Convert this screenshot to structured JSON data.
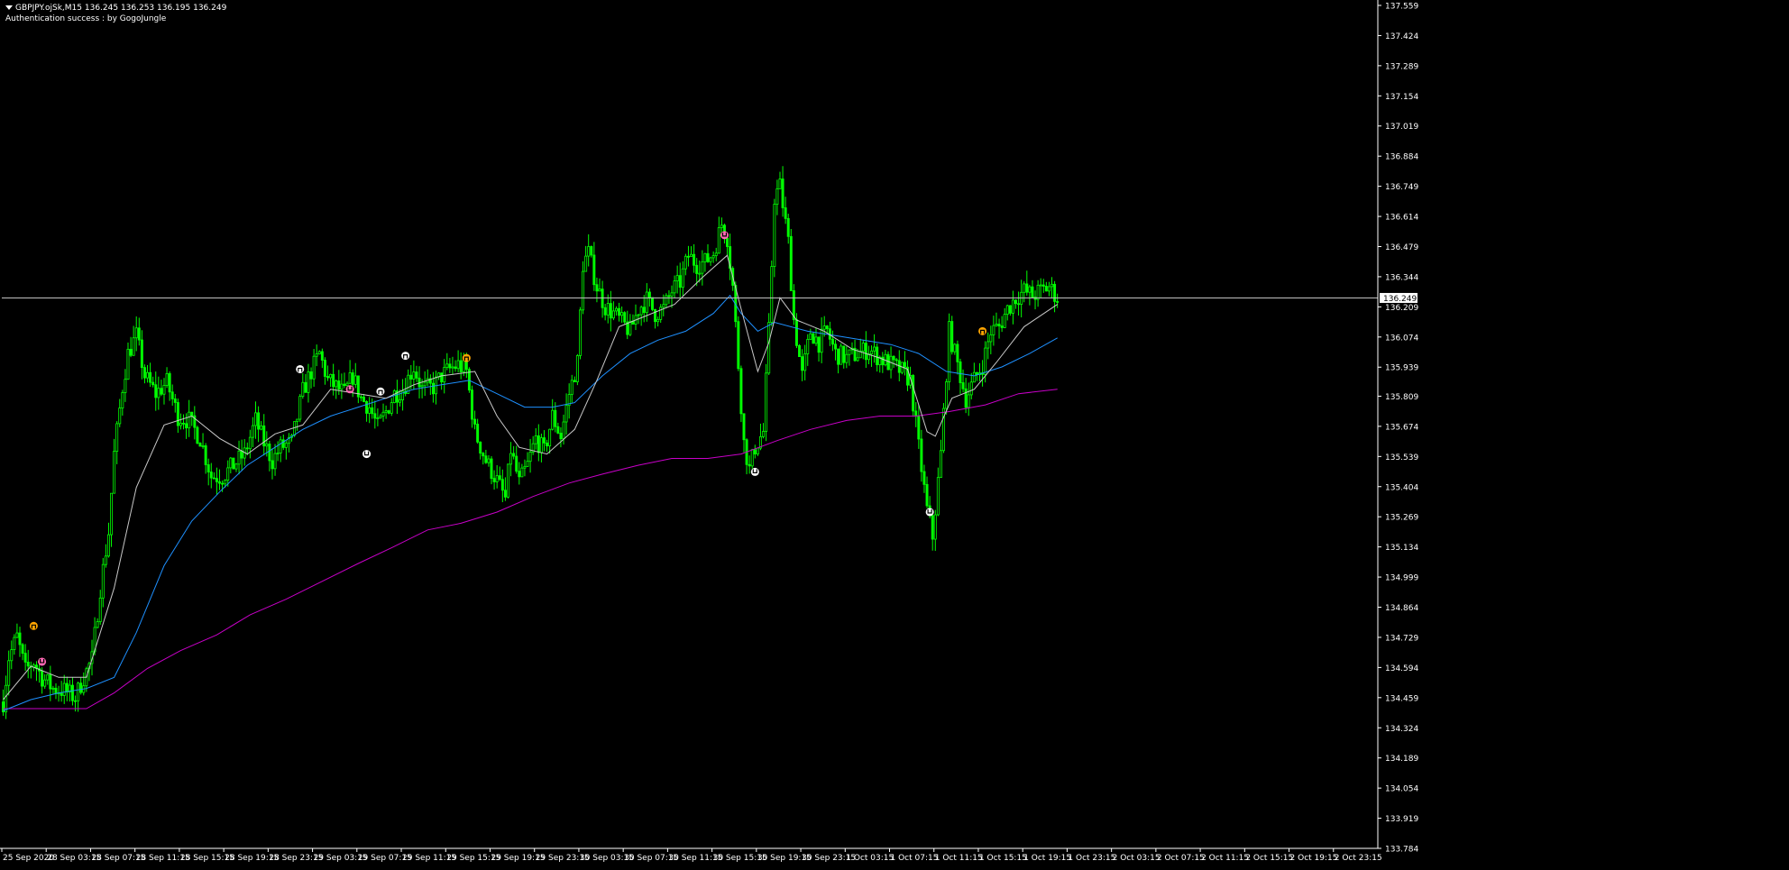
{
  "header": {
    "symbol_line": "GBPJPY.ojSk,M15  136.245 136.253 136.195 136.249",
    "auth_line": "Authentication success : by GogoJungle"
  },
  "colors": {
    "background": "#000000",
    "candle": "#00ff00",
    "ma_fast": "#c8c8c8",
    "ma_mid": "#1e90ff",
    "ma_slow": "#c800c8",
    "axis": "#ffffff",
    "price_line": "#c0c0c0",
    "sig_white": "#ffffff",
    "sig_orange": "#ffa500",
    "sig_pink": "#ff69b4"
  },
  "chart_data": {
    "type": "candlestick",
    "symbol": "GBPJPY.ojSk",
    "timeframe": "M15",
    "ohlc_current": {
      "open": 136.245,
      "high": 136.253,
      "low": 136.195,
      "close": 136.249
    },
    "current_price_label": "136.249",
    "current_price": 136.249,
    "ylim": [
      133.784,
      137.559
    ],
    "y_ticks": [
      "137.559",
      "137.424",
      "137.289",
      "137.154",
      "137.019",
      "136.884",
      "136.749",
      "136.614",
      "136.479",
      "136.344",
      "136.209",
      "136.074",
      "135.939",
      "135.809",
      "135.674",
      "135.539",
      "135.404",
      "135.269",
      "135.134",
      "134.999",
      "134.864",
      "134.729",
      "134.594",
      "134.459",
      "134.324",
      "134.189",
      "134.054",
      "133.919",
      "133.784"
    ],
    "x_ticks": [
      "25 Sep 2020",
      "28 Sep 03:15",
      "28 Sep 07:15",
      "28 Sep 11:15",
      "28 Sep 15:15",
      "28 Sep 19:15",
      "28 Sep 23:15",
      "29 Sep 03:15",
      "29 Sep 07:15",
      "29 Sep 11:15",
      "29 Sep 15:15",
      "29 Sep 19:15",
      "29 Sep 23:15",
      "30 Sep 03:15",
      "30 Sep 07:15",
      "30 Sep 11:15",
      "30 Sep 15:15",
      "30 Sep 19:15",
      "30 Sep 23:15",
      "1 Oct 03:15",
      "1 Oct 07:15",
      "1 Oct 11:15",
      "1 Oct 15:15",
      "1 Oct 19:15",
      "1 Oct 23:15",
      "2 Oct 03:15",
      "2 Oct 07:15",
      "2 Oct 11:15",
      "2 Oct 15:15",
      "2 Oct 19:15",
      "2 Oct 23:15"
    ],
    "bars_per_tick": 16,
    "close_path": [
      [
        0,
        134.44
      ],
      [
        2,
        134.64
      ],
      [
        5,
        134.73
      ],
      [
        8,
        134.58
      ],
      [
        11,
        134.62
      ],
      [
        14,
        134.55
      ],
      [
        18,
        134.5
      ],
      [
        22,
        134.49
      ],
      [
        26,
        134.46
      ],
      [
        29,
        134.55
      ],
      [
        32,
        134.63
      ],
      [
        35,
        134.95
      ],
      [
        38,
        135.2
      ],
      [
        40,
        135.55
      ],
      [
        43,
        135.85
      ],
      [
        45,
        136.0
      ],
      [
        48,
        136.08
      ],
      [
        51,
        135.9
      ],
      [
        55,
        135.82
      ],
      [
        59,
        135.87
      ],
      [
        63,
        135.72
      ],
      [
        67,
        135.7
      ],
      [
        71,
        135.62
      ],
      [
        75,
        135.45
      ],
      [
        79,
        135.45
      ],
      [
        83,
        135.5
      ],
      [
        87,
        135.55
      ],
      [
        91,
        135.7
      ],
      [
        94,
        135.6
      ],
      [
        97,
        135.52
      ],
      [
        100,
        135.58
      ],
      [
        104,
        135.6
      ],
      [
        108,
        135.83
      ],
      [
        111,
        135.92
      ],
      [
        114,
        136.0
      ],
      [
        117,
        135.88
      ],
      [
        120,
        135.85
      ],
      [
        123,
        135.82
      ],
      [
        126,
        135.9
      ],
      [
        129,
        135.8
      ],
      [
        132,
        135.76
      ],
      [
        135,
        135.67
      ],
      [
        138,
        135.74
      ],
      [
        141,
        135.82
      ],
      [
        144,
        135.84
      ],
      [
        148,
        135.94
      ],
      [
        151,
        135.84
      ],
      [
        155,
        135.85
      ],
      [
        158,
        135.9
      ],
      [
        161,
        135.93
      ],
      [
        164,
        135.95
      ],
      [
        167,
        135.92
      ],
      [
        170,
        135.65
      ],
      [
        174,
        135.52
      ],
      [
        178,
        135.43
      ],
      [
        181,
        135.35
      ],
      [
        183,
        135.57
      ],
      [
        186,
        135.42
      ],
      [
        189,
        135.5
      ],
      [
        192,
        135.62
      ],
      [
        195,
        135.56
      ],
      [
        198,
        135.72
      ],
      [
        201,
        135.63
      ],
      [
        204,
        135.82
      ],
      [
        207,
        135.96
      ],
      [
        209,
        136.4
      ],
      [
        211,
        136.45
      ],
      [
        214,
        136.3
      ],
      [
        217,
        136.21
      ],
      [
        220,
        136.18
      ],
      [
        223,
        136.14
      ],
      [
        226,
        136.1
      ],
      [
        229,
        136.2
      ],
      [
        232,
        136.24
      ],
      [
        235,
        136.18
      ],
      [
        238,
        136.2
      ],
      [
        241,
        136.28
      ],
      [
        244,
        136.32
      ],
      [
        247,
        136.44
      ],
      [
        250,
        136.4
      ],
      [
        253,
        136.41
      ],
      [
        256,
        136.45
      ],
      [
        259,
        136.58
      ],
      [
        261,
        136.52
      ],
      [
        263,
        136.3
      ],
      [
        265,
        135.95
      ],
      [
        267,
        135.6
      ],
      [
        269,
        135.48
      ],
      [
        271,
        135.58
      ],
      [
        274,
        135.65
      ],
      [
        276,
        136.1
      ],
      [
        278,
        136.7
      ],
      [
        280,
        136.75
      ],
      [
        283,
        136.5
      ],
      [
        285,
        136.15
      ],
      [
        288,
        135.9
      ],
      [
        291,
        136.1
      ],
      [
        294,
        136.05
      ],
      [
        297,
        136.1
      ],
      [
        300,
        136.0
      ],
      [
        304,
        135.98
      ],
      [
        308,
        136.0
      ],
      [
        312,
        136.02
      ],
      [
        316,
        135.98
      ],
      [
        320,
        135.95
      ],
      [
        324,
        135.92
      ],
      [
        327,
        135.88
      ],
      [
        330,
        135.58
      ],
      [
        333,
        135.3
      ],
      [
        335,
        135.18
      ],
      [
        338,
        135.55
      ],
      [
        341,
        136.1
      ],
      [
        344,
        135.95
      ],
      [
        347,
        135.8
      ],
      [
        350,
        135.88
      ],
      [
        353,
        135.95
      ],
      [
        356,
        136.1
      ],
      [
        359,
        136.12
      ],
      [
        362,
        136.2
      ],
      [
        365,
        136.25
      ],
      [
        368,
        136.28
      ],
      [
        371,
        136.26
      ],
      [
        374,
        136.28
      ],
      [
        377,
        136.3
      ],
      [
        380,
        136.25
      ]
    ],
    "ma_fast": [
      [
        0,
        134.45
      ],
      [
        10,
        134.6
      ],
      [
        20,
        134.55
      ],
      [
        30,
        134.55
      ],
      [
        40,
        134.95
      ],
      [
        48,
        135.4
      ],
      [
        58,
        135.68
      ],
      [
        68,
        135.72
      ],
      [
        78,
        135.62
      ],
      [
        88,
        135.55
      ],
      [
        98,
        135.64
      ],
      [
        108,
        135.68
      ],
      [
        118,
        135.84
      ],
      [
        128,
        135.82
      ],
      [
        138,
        135.8
      ],
      [
        148,
        135.86
      ],
      [
        158,
        135.9
      ],
      [
        170,
        135.92
      ],
      [
        178,
        135.72
      ],
      [
        186,
        135.58
      ],
      [
        196,
        135.55
      ],
      [
        206,
        135.66
      ],
      [
        214,
        135.88
      ],
      [
        222,
        136.12
      ],
      [
        232,
        136.17
      ],
      [
        242,
        136.22
      ],
      [
        252,
        136.34
      ],
      [
        261,
        136.44
      ],
      [
        266,
        136.2
      ],
      [
        272,
        135.92
      ],
      [
        276,
        136.05
      ],
      [
        280,
        136.25
      ],
      [
        286,
        136.15
      ],
      [
        296,
        136.1
      ],
      [
        306,
        136.02
      ],
      [
        316,
        135.98
      ],
      [
        326,
        135.93
      ],
      [
        333,
        135.65
      ],
      [
        336,
        135.63
      ],
      [
        342,
        135.8
      ],
      [
        350,
        135.84
      ],
      [
        358,
        135.96
      ],
      [
        368,
        136.12
      ],
      [
        380,
        136.22
      ]
    ],
    "ma_mid": [
      [
        0,
        134.4
      ],
      [
        10,
        134.45
      ],
      [
        20,
        134.48
      ],
      [
        30,
        134.5
      ],
      [
        40,
        134.55
      ],
      [
        48,
        134.75
      ],
      [
        58,
        135.05
      ],
      [
        68,
        135.25
      ],
      [
        78,
        135.38
      ],
      [
        88,
        135.5
      ],
      [
        98,
        135.58
      ],
      [
        108,
        135.66
      ],
      [
        118,
        135.72
      ],
      [
        128,
        135.76
      ],
      [
        138,
        135.8
      ],
      [
        148,
        135.84
      ],
      [
        158,
        135.86
      ],
      [
        168,
        135.88
      ],
      [
        178,
        135.82
      ],
      [
        188,
        135.76
      ],
      [
        198,
        135.76
      ],
      [
        206,
        135.78
      ],
      [
        216,
        135.9
      ],
      [
        226,
        136.0
      ],
      [
        236,
        136.06
      ],
      [
        246,
        136.1
      ],
      [
        256,
        136.18
      ],
      [
        262,
        136.26
      ],
      [
        266,
        136.18
      ],
      [
        272,
        136.1
      ],
      [
        278,
        136.14
      ],
      [
        290,
        136.1
      ],
      [
        300,
        136.08
      ],
      [
        310,
        136.06
      ],
      [
        320,
        136.04
      ],
      [
        330,
        136.0
      ],
      [
        340,
        135.92
      ],
      [
        350,
        135.9
      ],
      [
        360,
        135.94
      ],
      [
        370,
        136.0
      ],
      [
        380,
        136.07
      ]
    ],
    "ma_slow": [
      [
        0,
        134.41
      ],
      [
        30,
        134.41
      ],
      [
        40,
        134.48
      ],
      [
        52,
        134.59
      ],
      [
        64,
        134.67
      ],
      [
        77,
        134.74
      ],
      [
        89,
        134.83
      ],
      [
        102,
        134.9
      ],
      [
        115,
        134.98
      ],
      [
        128,
        135.06
      ],
      [
        140,
        135.13
      ],
      [
        153,
        135.21
      ],
      [
        165,
        135.24
      ],
      [
        178,
        135.29
      ],
      [
        191,
        135.36
      ],
      [
        204,
        135.42
      ],
      [
        216,
        135.46
      ],
      [
        229,
        135.5
      ],
      [
        241,
        135.53
      ],
      [
        254,
        135.53
      ],
      [
        266,
        135.55
      ],
      [
        279,
        135.61
      ],
      [
        291,
        135.66
      ],
      [
        304,
        135.7
      ],
      [
        316,
        135.72
      ],
      [
        329,
        135.72
      ],
      [
        341,
        135.74
      ],
      [
        354,
        135.77
      ],
      [
        366,
        135.82
      ],
      [
        380,
        135.84
      ]
    ],
    "signals": [
      {
        "bar": 11,
        "price": 134.78,
        "color": "orange",
        "dir": "up"
      },
      {
        "bar": 14,
        "price": 134.62,
        "color": "pink",
        "dir": "down"
      },
      {
        "bar": 107,
        "price": 135.93,
        "color": "white",
        "dir": "up"
      },
      {
        "bar": 125,
        "price": 135.84,
        "color": "pink",
        "dir": "down"
      },
      {
        "bar": 131,
        "price": 135.55,
        "color": "white",
        "dir": "down"
      },
      {
        "bar": 136,
        "price": 135.83,
        "color": "white",
        "dir": "up"
      },
      {
        "bar": 145,
        "price": 135.99,
        "color": "white",
        "dir": "up"
      },
      {
        "bar": 167,
        "price": 135.98,
        "color": "orange",
        "dir": "up"
      },
      {
        "bar": 260,
        "price": 136.53,
        "color": "pink",
        "dir": "down"
      },
      {
        "bar": 271,
        "price": 135.47,
        "color": "white",
        "dir": "down"
      },
      {
        "bar": 334,
        "price": 135.29,
        "color": "white",
        "dir": "down"
      },
      {
        "bar": 353,
        "price": 136.1,
        "color": "orange",
        "dir": "up"
      }
    ]
  }
}
